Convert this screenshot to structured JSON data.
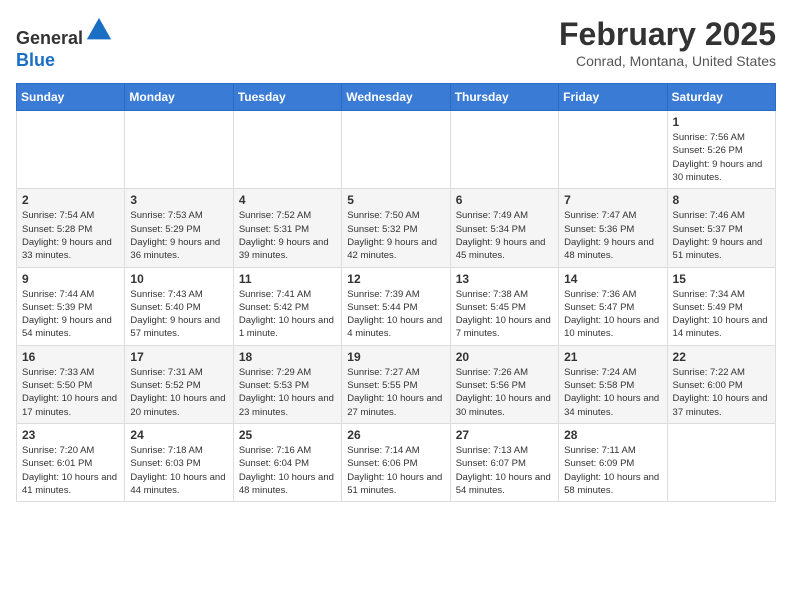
{
  "header": {
    "logo_line1": "General",
    "logo_line2": "Blue",
    "month": "February 2025",
    "location": "Conrad, Montana, United States"
  },
  "days_of_week": [
    "Sunday",
    "Monday",
    "Tuesday",
    "Wednesday",
    "Thursday",
    "Friday",
    "Saturday"
  ],
  "weeks": [
    [
      {
        "day": "",
        "info": ""
      },
      {
        "day": "",
        "info": ""
      },
      {
        "day": "",
        "info": ""
      },
      {
        "day": "",
        "info": ""
      },
      {
        "day": "",
        "info": ""
      },
      {
        "day": "",
        "info": ""
      },
      {
        "day": "1",
        "info": "Sunrise: 7:56 AM\nSunset: 5:26 PM\nDaylight: 9 hours and 30 minutes."
      }
    ],
    [
      {
        "day": "2",
        "info": "Sunrise: 7:54 AM\nSunset: 5:28 PM\nDaylight: 9 hours and 33 minutes."
      },
      {
        "day": "3",
        "info": "Sunrise: 7:53 AM\nSunset: 5:29 PM\nDaylight: 9 hours and 36 minutes."
      },
      {
        "day": "4",
        "info": "Sunrise: 7:52 AM\nSunset: 5:31 PM\nDaylight: 9 hours and 39 minutes."
      },
      {
        "day": "5",
        "info": "Sunrise: 7:50 AM\nSunset: 5:32 PM\nDaylight: 9 hours and 42 minutes."
      },
      {
        "day": "6",
        "info": "Sunrise: 7:49 AM\nSunset: 5:34 PM\nDaylight: 9 hours and 45 minutes."
      },
      {
        "day": "7",
        "info": "Sunrise: 7:47 AM\nSunset: 5:36 PM\nDaylight: 9 hours and 48 minutes."
      },
      {
        "day": "8",
        "info": "Sunrise: 7:46 AM\nSunset: 5:37 PM\nDaylight: 9 hours and 51 minutes."
      }
    ],
    [
      {
        "day": "9",
        "info": "Sunrise: 7:44 AM\nSunset: 5:39 PM\nDaylight: 9 hours and 54 minutes."
      },
      {
        "day": "10",
        "info": "Sunrise: 7:43 AM\nSunset: 5:40 PM\nDaylight: 9 hours and 57 minutes."
      },
      {
        "day": "11",
        "info": "Sunrise: 7:41 AM\nSunset: 5:42 PM\nDaylight: 10 hours and 1 minute."
      },
      {
        "day": "12",
        "info": "Sunrise: 7:39 AM\nSunset: 5:44 PM\nDaylight: 10 hours and 4 minutes."
      },
      {
        "day": "13",
        "info": "Sunrise: 7:38 AM\nSunset: 5:45 PM\nDaylight: 10 hours and 7 minutes."
      },
      {
        "day": "14",
        "info": "Sunrise: 7:36 AM\nSunset: 5:47 PM\nDaylight: 10 hours and 10 minutes."
      },
      {
        "day": "15",
        "info": "Sunrise: 7:34 AM\nSunset: 5:49 PM\nDaylight: 10 hours and 14 minutes."
      }
    ],
    [
      {
        "day": "16",
        "info": "Sunrise: 7:33 AM\nSunset: 5:50 PM\nDaylight: 10 hours and 17 minutes."
      },
      {
        "day": "17",
        "info": "Sunrise: 7:31 AM\nSunset: 5:52 PM\nDaylight: 10 hours and 20 minutes."
      },
      {
        "day": "18",
        "info": "Sunrise: 7:29 AM\nSunset: 5:53 PM\nDaylight: 10 hours and 23 minutes."
      },
      {
        "day": "19",
        "info": "Sunrise: 7:27 AM\nSunset: 5:55 PM\nDaylight: 10 hours and 27 minutes."
      },
      {
        "day": "20",
        "info": "Sunrise: 7:26 AM\nSunset: 5:56 PM\nDaylight: 10 hours and 30 minutes."
      },
      {
        "day": "21",
        "info": "Sunrise: 7:24 AM\nSunset: 5:58 PM\nDaylight: 10 hours and 34 minutes."
      },
      {
        "day": "22",
        "info": "Sunrise: 7:22 AM\nSunset: 6:00 PM\nDaylight: 10 hours and 37 minutes."
      }
    ],
    [
      {
        "day": "23",
        "info": "Sunrise: 7:20 AM\nSunset: 6:01 PM\nDaylight: 10 hours and 41 minutes."
      },
      {
        "day": "24",
        "info": "Sunrise: 7:18 AM\nSunset: 6:03 PM\nDaylight: 10 hours and 44 minutes."
      },
      {
        "day": "25",
        "info": "Sunrise: 7:16 AM\nSunset: 6:04 PM\nDaylight: 10 hours and 48 minutes."
      },
      {
        "day": "26",
        "info": "Sunrise: 7:14 AM\nSunset: 6:06 PM\nDaylight: 10 hours and 51 minutes."
      },
      {
        "day": "27",
        "info": "Sunrise: 7:13 AM\nSunset: 6:07 PM\nDaylight: 10 hours and 54 minutes."
      },
      {
        "day": "28",
        "info": "Sunrise: 7:11 AM\nSunset: 6:09 PM\nDaylight: 10 hours and 58 minutes."
      },
      {
        "day": "",
        "info": ""
      }
    ]
  ]
}
